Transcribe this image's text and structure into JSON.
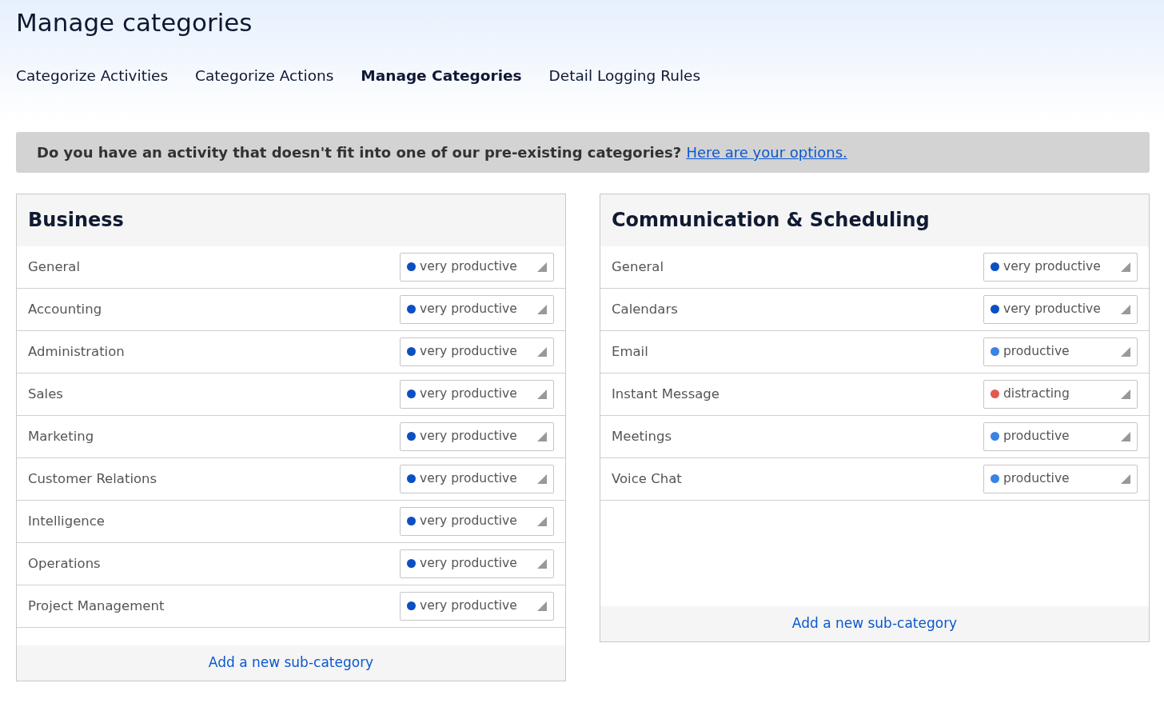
{
  "page": {
    "title": "Manage categories"
  },
  "tabs": [
    {
      "label": "Categorize Activities",
      "selected": false
    },
    {
      "label": "Categorize Actions",
      "selected": false
    },
    {
      "label": "Manage Categories",
      "selected": true
    },
    {
      "label": "Detail Logging Rules",
      "selected": false
    }
  ],
  "banner": {
    "text": "Do you have an activity that doesn't fit into one of our pre-existing categories?",
    "link": "Here are your options."
  },
  "categories": [
    {
      "title": "Business",
      "add_link": "Add a new sub-category",
      "rows": [
        {
          "name": "General",
          "productivity": "very productive",
          "color": "#0b4fc4"
        },
        {
          "name": "Accounting",
          "productivity": "very productive",
          "color": "#0b4fc4"
        },
        {
          "name": "Administration",
          "productivity": "very productive",
          "color": "#0b4fc4"
        },
        {
          "name": "Sales",
          "productivity": "very productive",
          "color": "#0b4fc4"
        },
        {
          "name": "Marketing",
          "productivity": "very productive",
          "color": "#0b4fc4"
        },
        {
          "name": "Customer Relations",
          "productivity": "very productive",
          "color": "#0b4fc4"
        },
        {
          "name": "Intelligence",
          "productivity": "very productive",
          "color": "#0b4fc4"
        },
        {
          "name": "Operations",
          "productivity": "very productive",
          "color": "#0b4fc4"
        },
        {
          "name": "Project Management",
          "productivity": "very productive",
          "color": "#0b4fc4"
        }
      ]
    },
    {
      "title": "Communication & Scheduling",
      "add_link": "Add a new sub-category",
      "rows": [
        {
          "name": "General",
          "productivity": "very productive",
          "color": "#0b4fc4"
        },
        {
          "name": "Calendars",
          "productivity": "very productive",
          "color": "#0b4fc4"
        },
        {
          "name": "Email",
          "productivity": "productive",
          "color": "#3b82e6"
        },
        {
          "name": "Instant Message",
          "productivity": "distracting",
          "color": "#e05a50"
        },
        {
          "name": "Meetings",
          "productivity": "productive",
          "color": "#3b82e6"
        },
        {
          "name": "Voice Chat",
          "productivity": "productive",
          "color": "#3b82e6"
        }
      ]
    }
  ]
}
